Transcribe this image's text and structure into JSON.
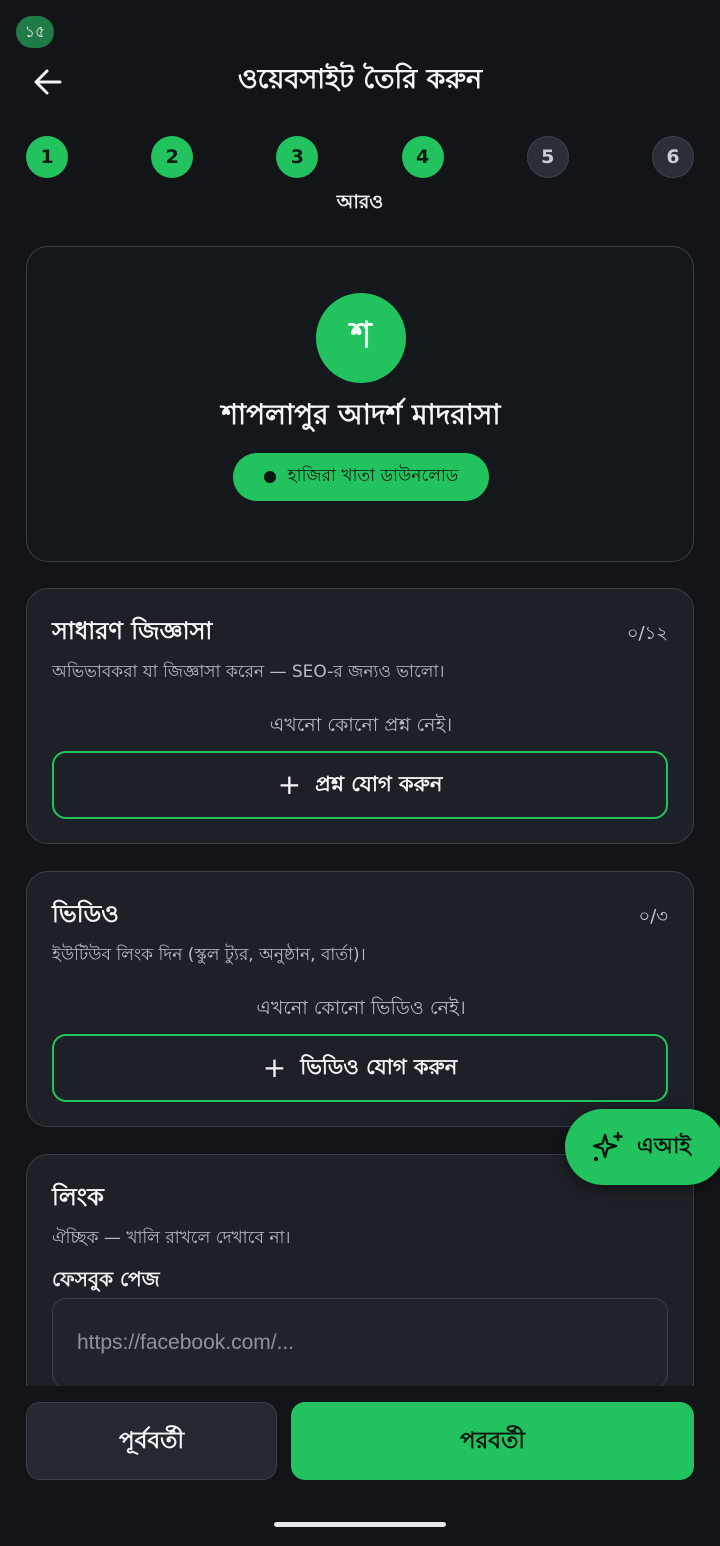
{
  "status": {
    "badge": "১৫"
  },
  "header": {
    "title": "ওয়েবসাইট তৈরি করুন"
  },
  "stepper": {
    "steps": [
      "1",
      "2",
      "3",
      "4",
      "5",
      "6"
    ],
    "current": 4,
    "caption": "আরও"
  },
  "school": {
    "avatar_letter": "শ",
    "name": "শাপলাপুর আদর্শ মাদরাসা",
    "pill_label": "হাজিরা খাতা ডাউনলোড"
  },
  "faq": {
    "title": "সাধারণ জিজ্ঞাসা",
    "count": "০/১২",
    "description": "অভিভাবকরা যা জিজ্ঞাসা করেন — SEO-র জন্যও ভালো।",
    "empty": "এখনো কোনো প্রশ্ন নেই।",
    "add_label": "প্রশ্ন যোগ করুন"
  },
  "video": {
    "title": "ভিডিও",
    "count": "০/৩",
    "description": "ইউটিউব লিংক দিন (স্কুল ট্যুর, অনুষ্ঠান, বার্তা)।",
    "empty": "এখনো কোনো ভিডিও নেই।",
    "add_label": "ভিডিও যোগ করুন"
  },
  "links": {
    "title": "লিংক",
    "description": "ঐচ্ছিক — খালি রাখলে দেখাবে না।",
    "facebook_label": "ফেসবুক পেজ",
    "facebook_placeholder": "https://facebook.com/...",
    "facebook_value": ""
  },
  "fab": {
    "label": "এআই",
    "icon": "sparkle-icon"
  },
  "footer": {
    "prev_label": "পূর্ববর্তী",
    "next_label": "পরবর্তী"
  },
  "colors": {
    "accent": "#22c35e",
    "background": "#121417",
    "card": "#1d2026"
  }
}
